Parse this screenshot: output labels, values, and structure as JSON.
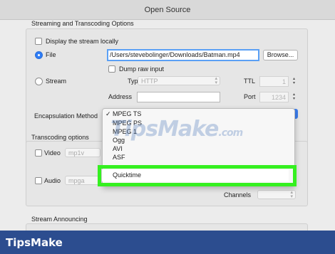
{
  "window": {
    "title": "Open Source"
  },
  "streaming": {
    "section_title": "Streaming and Transcoding Options",
    "display_locally_label": "Display the stream locally",
    "file_label": "File",
    "file_path": "/Users/stevebolinger/Downloads/Batman.mp4",
    "browse_label": "Browse...",
    "dump_raw_label": "Dump raw input",
    "stream_label": "Stream",
    "type_label": "Type",
    "type_value": "HTTP",
    "ttl_label": "TTL",
    "ttl_value": "1",
    "address_label": "Address",
    "address_value": "",
    "port_label": "Port",
    "port_value": "1234",
    "encapsulation_label": "Encapsulation Method"
  },
  "encapsulation_menu": {
    "items": [
      "MPEG TS",
      "MPEG PS",
      "MPEG 1",
      "Ogg",
      "AVI",
      "ASF"
    ],
    "checked_item": "MPEG TS",
    "highlighted_item": "Quicktime"
  },
  "transcoding": {
    "section_title": "Transcoding options",
    "video_label": "Video",
    "video_codec": "mp1v",
    "audio_label": "Audio",
    "audio_codec": "mpga",
    "channels_label": "Channels"
  },
  "announcing": {
    "section_title": "Stream Announcing"
  },
  "watermark": {
    "text": "TipsMake",
    "suffix": ".com"
  },
  "footer": {
    "brand": "TipsMake"
  },
  "colors": {
    "accent": "#2f7df6",
    "highlight_border": "#35f020",
    "footer_bg": "#2c4d8f"
  }
}
